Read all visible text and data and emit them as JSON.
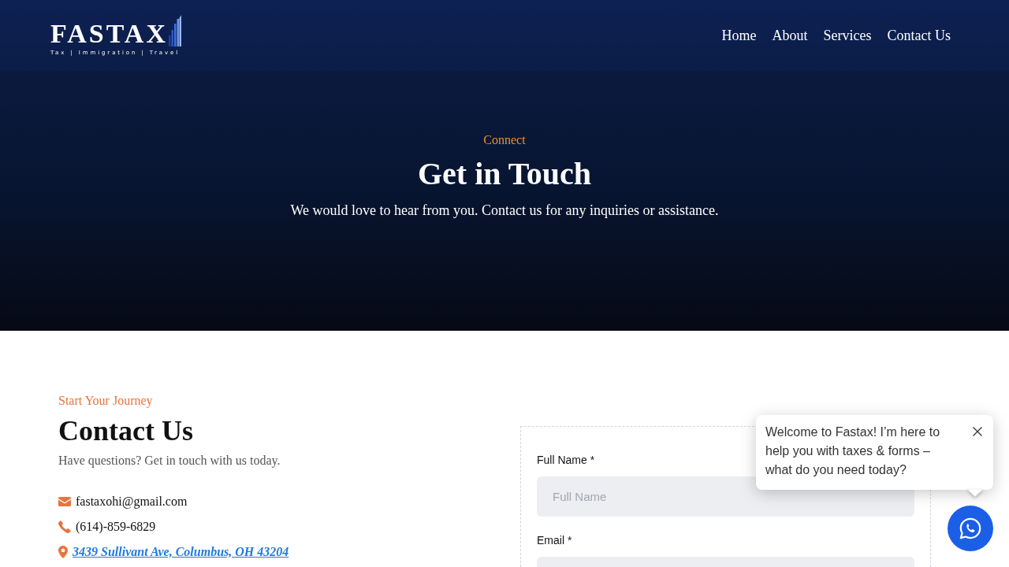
{
  "header": {
    "logo": {
      "name": "FASTAX",
      "tagline": "Tax | Immigration | Travel"
    },
    "nav": [
      {
        "label": "Home"
      },
      {
        "label": "About"
      },
      {
        "label": "Services"
      },
      {
        "label": "Contact Us"
      }
    ]
  },
  "hero": {
    "eyebrow": "Connect",
    "title": "Get in Touch",
    "subtitle": "We would love to hear from you. Contact us for any inquiries or assistance."
  },
  "contact": {
    "eyebrow": "Start Your Journey",
    "title": "Contact Us",
    "subtitle": "Have questions? Get in touch with us today.",
    "items": [
      {
        "kind": "email",
        "text": "fastaxohi@gmail.com"
      },
      {
        "kind": "phone",
        "text": "(614)-859-6829"
      },
      {
        "kind": "address",
        "text": "3439 Sullivant Ave, Columbus, OH 43204"
      }
    ]
  },
  "form": {
    "fields": [
      {
        "label": "Full Name *",
        "placeholder": "Full Name"
      },
      {
        "label": "Email *"
      }
    ]
  },
  "chat": {
    "message": "Welcome to Fastax! I’m here to help you with taxes & forms – what do you need today?"
  }
}
